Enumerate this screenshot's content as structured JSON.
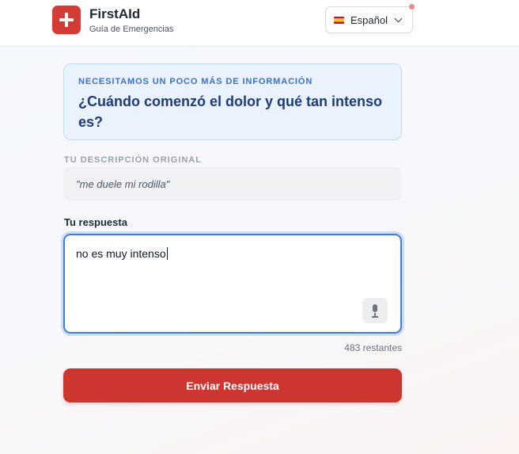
{
  "header": {
    "brand_name": "FirstAId",
    "brand_subtitle": "Guía de Emergencias",
    "logo_icon": "medical-cross-icon",
    "language": {
      "label": "Español",
      "flag_icon": "spain-flag-icon",
      "chevron_icon": "chevron-down-icon"
    }
  },
  "question": {
    "kicker": "NECESITAMOS UN POCO MÁS DE INFORMACIÓN",
    "text": "¿Cuándo comenzó el dolor y qué tan intenso es?"
  },
  "original": {
    "label": "TU DESCRIPCIÓN ORIGINAL",
    "text": "\"me duele mi rodilla\""
  },
  "response": {
    "label": "Tu respuesta",
    "value": "no es muy intenso",
    "mic_icon": "microphone-icon",
    "remaining": "483 restantes"
  },
  "submit_label": "Enviar Respuesta",
  "colors": {
    "brand_red": "#cd3531",
    "focus_blue": "#3f7ee0",
    "question_text": "#1e3a78",
    "kicker_blue": "#3b6fd1"
  }
}
